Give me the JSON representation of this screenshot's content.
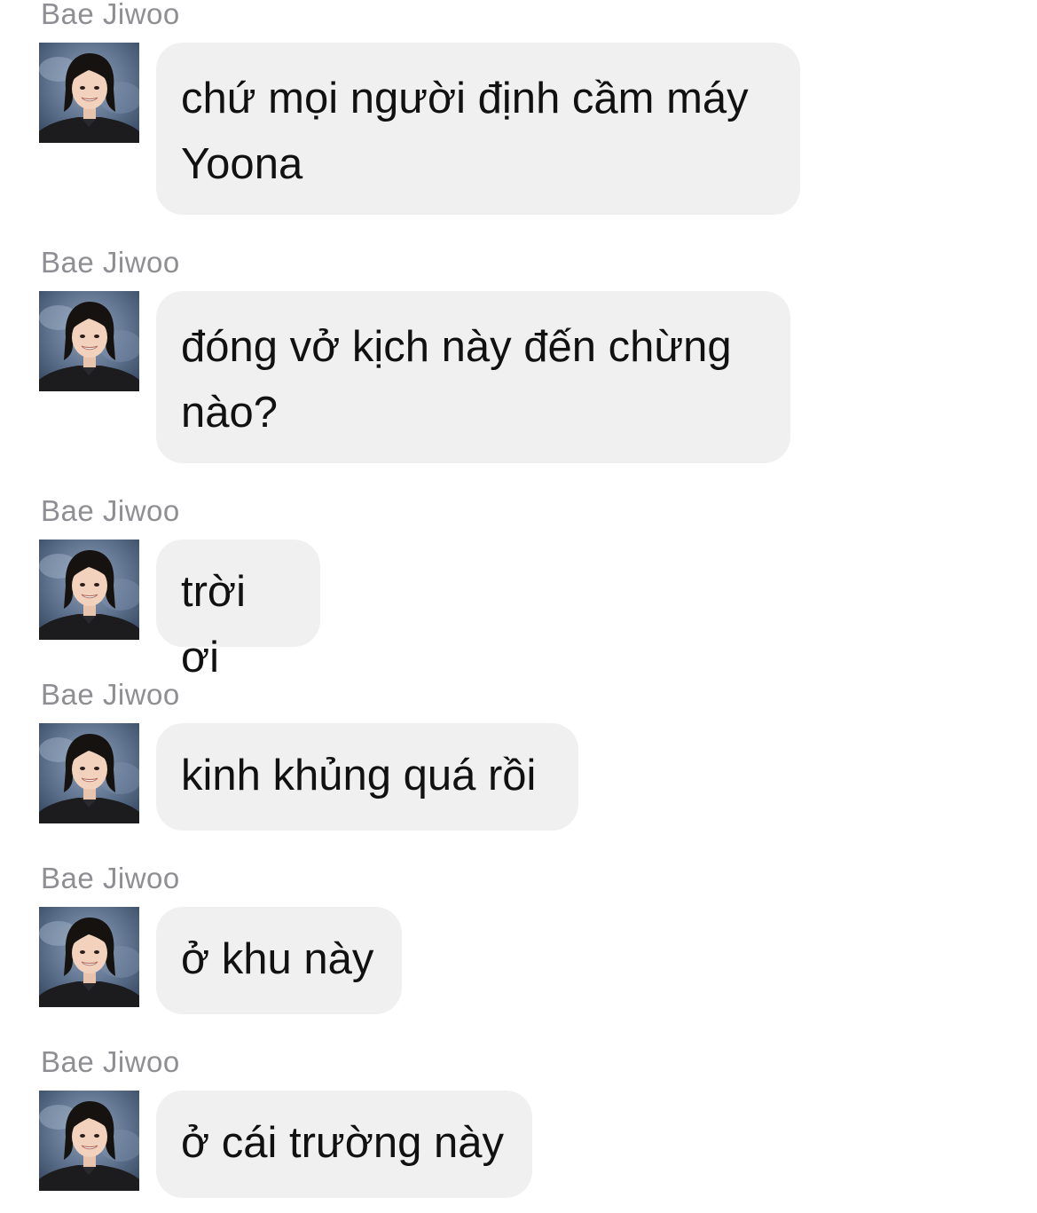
{
  "conversation": {
    "messages": [
      {
        "sender": "Bae Jiwoo",
        "text": "chứ mọi người định cầm máy Yoona"
      },
      {
        "sender": "Bae Jiwoo",
        "text": "đóng vở kịch này đến chừng nào?"
      },
      {
        "sender": "Bae Jiwoo",
        "text": "trời ơi"
      },
      {
        "sender": "Bae Jiwoo",
        "text": "kinh khủng quá rồi"
      },
      {
        "sender": "Bae Jiwoo",
        "text": "ở khu này"
      },
      {
        "sender": "Bae Jiwoo",
        "text": "ở cái trường này"
      }
    ]
  },
  "colors": {
    "background": "#ffffff",
    "bubble": "#f0f0f0",
    "sender_name": "#8e8e93",
    "message_text": "#111111"
  },
  "icons": {
    "avatar": "profile-photo"
  }
}
